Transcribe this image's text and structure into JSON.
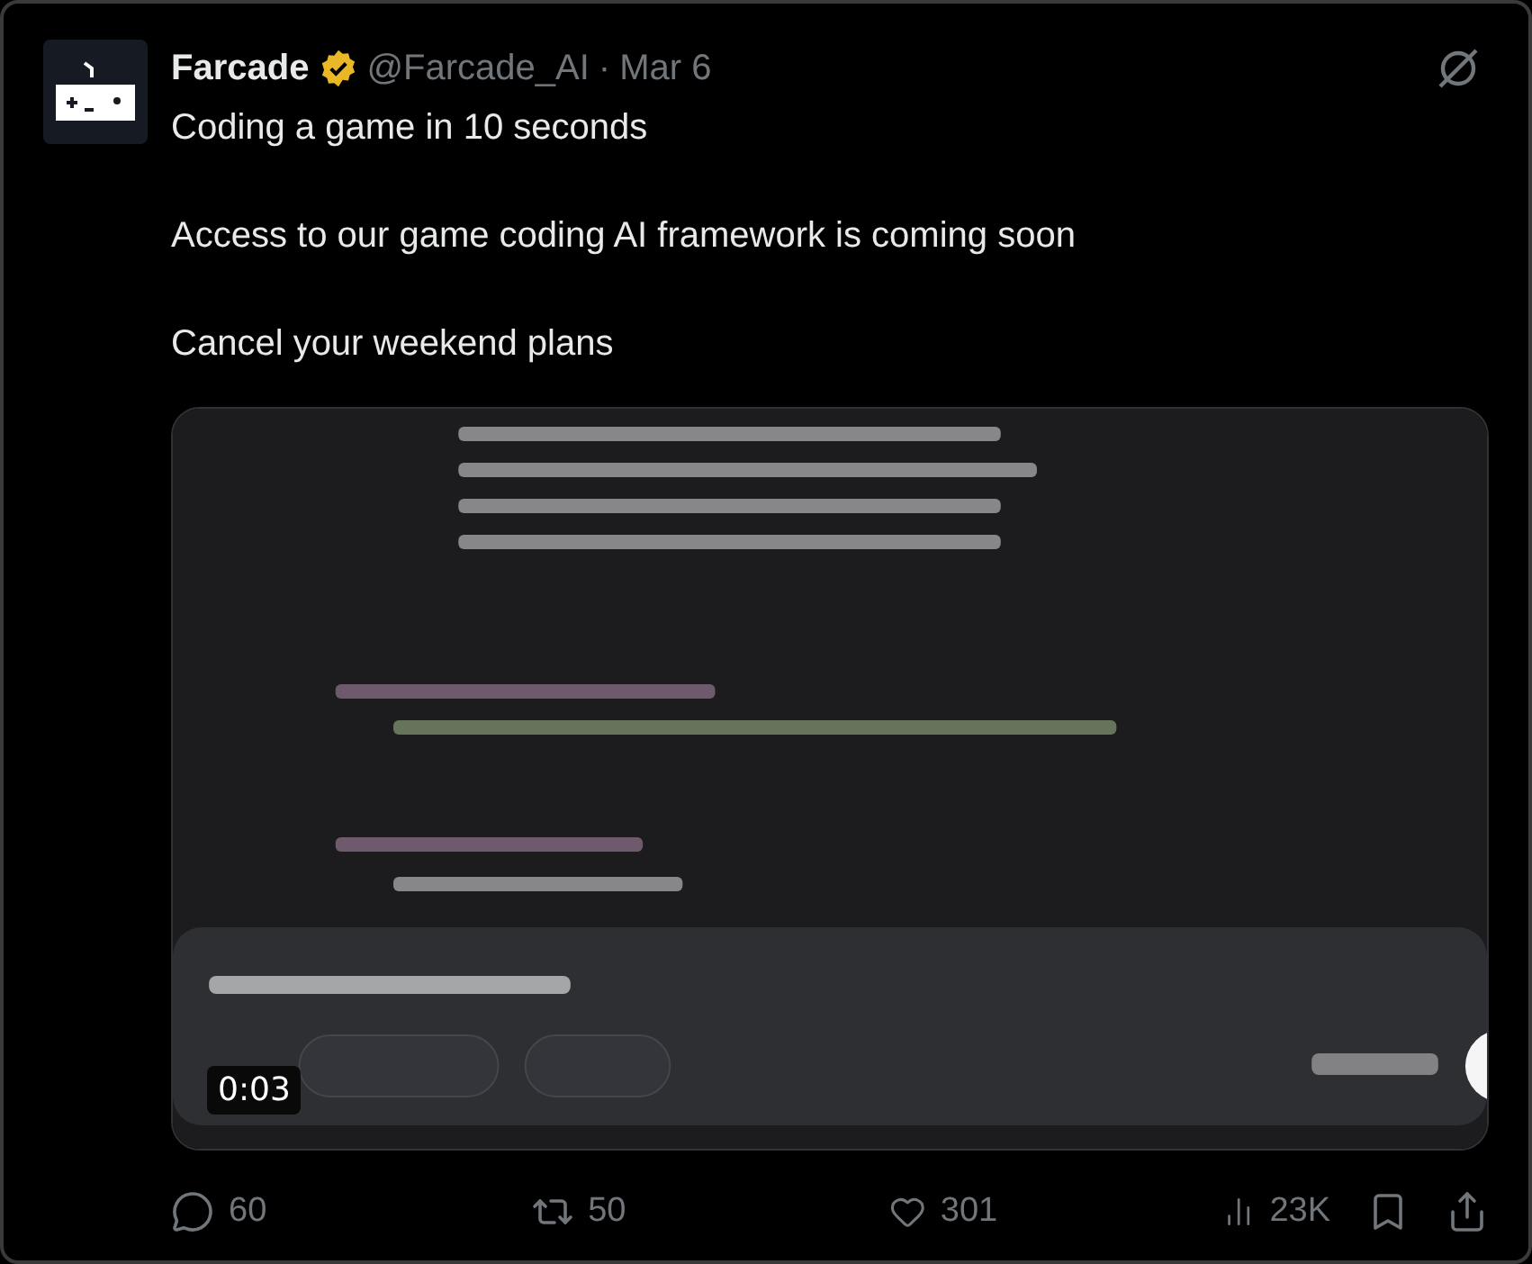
{
  "post": {
    "author": "Farcade",
    "verified": true,
    "handle": "@Farcade_AI",
    "separator": "·",
    "date": "Mar 6",
    "paragraphs": [
      "Coding a game in 10 seconds",
      "Access to our game coding AI framework is coming soon",
      "Cancel your weekend plans"
    ],
    "media": {
      "kind": "picture",
      "duration": "0:03"
    },
    "actions": [
      {
        "kind": "reply",
        "count": "60"
      },
      {
        "kind": "repost",
        "count": "50"
      },
      {
        "kind": "like",
        "count": "301"
      },
      {
        "kind": "views",
        "count": "23K"
      }
    ]
  }
}
